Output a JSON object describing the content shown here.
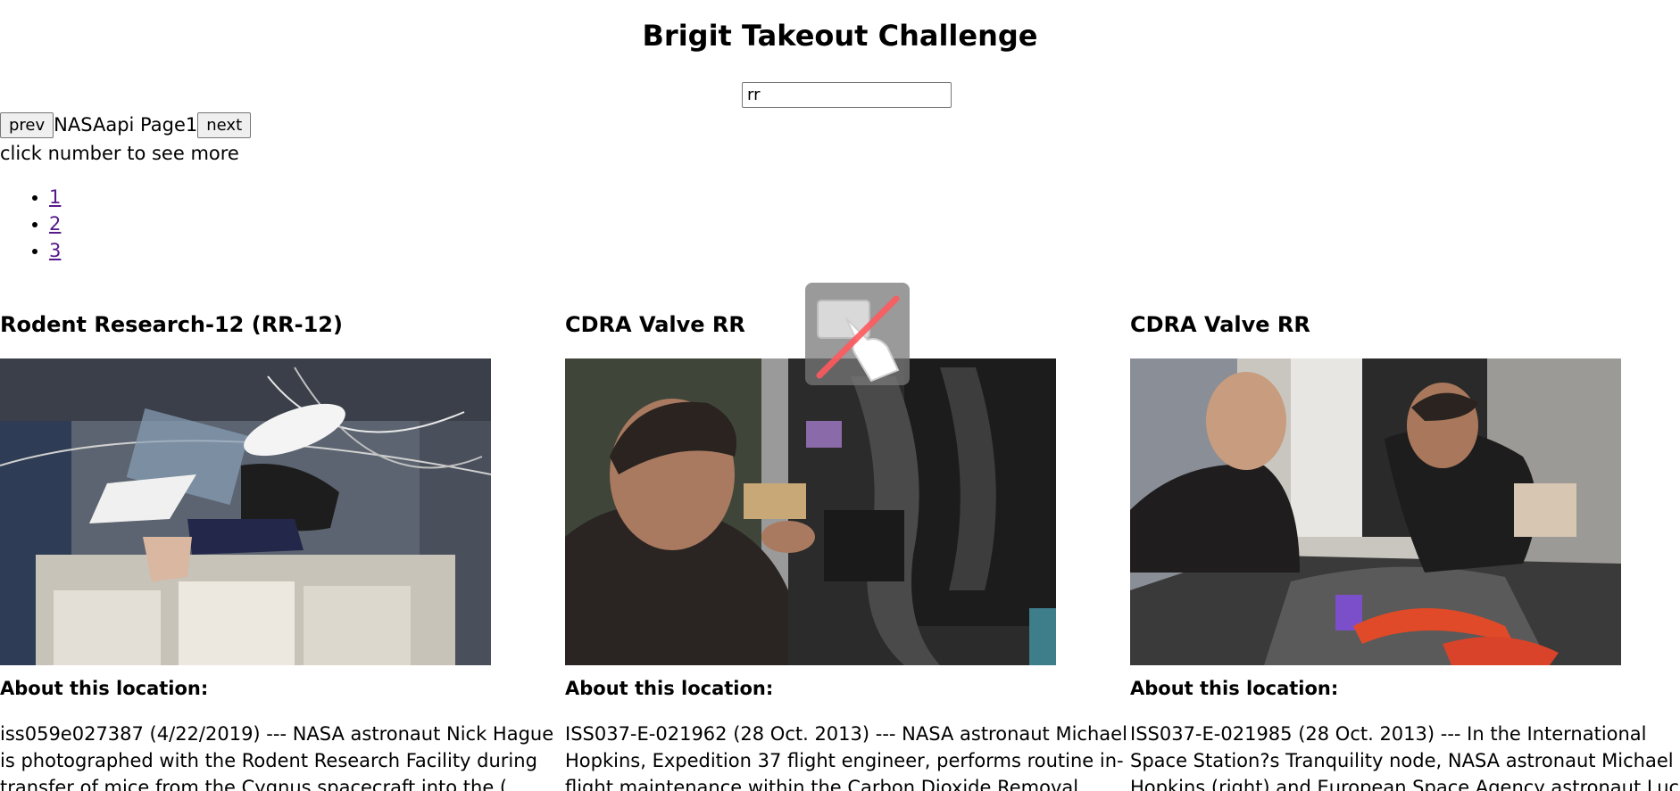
{
  "header": {
    "title": "Brigit Takeout Challenge"
  },
  "search": {
    "value": "rr",
    "placeholder": ""
  },
  "pager": {
    "prev_label": "prev",
    "text": "NASAapi Page1",
    "next_label": "next"
  },
  "hint": "click number to see more",
  "pages": [
    "1",
    "2",
    "3"
  ],
  "cards": [
    {
      "title": "Rodent Research-12 (RR-12)",
      "about_label": "About this location:",
      "description": "iss059e027387 (4/22/2019) --- NASA astronaut Nick Hague is photographed with the Rodent Research Facility during transfer of mice from the Cygnus spacecraft into the ( International Space"
    },
    {
      "title": "CDRA Valve RR",
      "about_label": "About this location:",
      "description": "ISS037-E-021962 (28 Oct. 2013) --- NASA astronaut Michael Hopkins, Expedition 37 flight engineer, performs routine in-flight maintenance within the Carbon Dioxide Removal Assembly in the"
    },
    {
      "title": "CDRA Valve RR",
      "about_label": "About this location:",
      "description": "ISS037-E-021985 (28 Oct. 2013) --- In the International Space Station?s Tranquility node, NASA astronaut Michael Hopkins (right) and European Space Agency astronaut Luca Parmitano"
    }
  ],
  "icons": {
    "overlay": "touch-disabled-icon"
  }
}
